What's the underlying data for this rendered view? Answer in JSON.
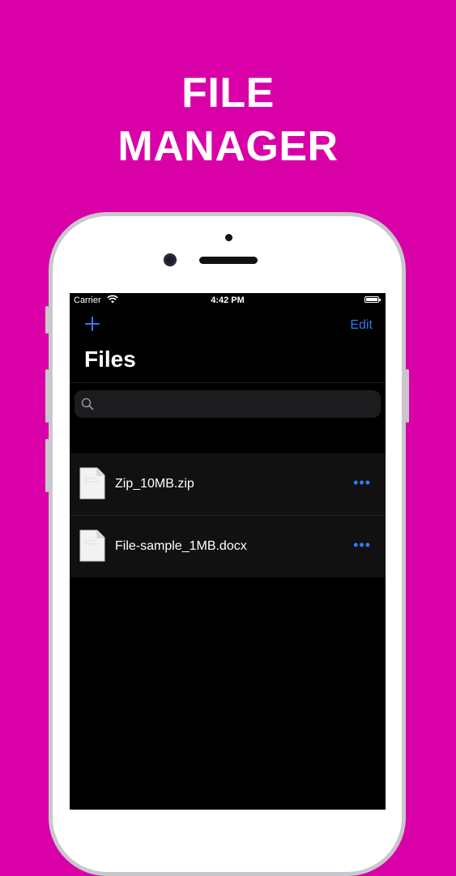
{
  "banner": {
    "line1": "FILE",
    "line2": "MANAGER"
  },
  "status_bar": {
    "carrier": "Carrier",
    "time": "4:42 PM"
  },
  "nav": {
    "add_label": "+",
    "edit_label": "Edit",
    "title": "Files"
  },
  "search": {
    "placeholder": "",
    "value": ""
  },
  "files": [
    {
      "name": "Zip_10MB.zip",
      "more": "•••"
    },
    {
      "name": "File-sample_1MB.docx",
      "more": "•••"
    }
  ],
  "colors": {
    "background": "#d900a8",
    "accent": "#2f7cf6",
    "screen": "#000000"
  },
  "icons": {
    "add": "plus-icon",
    "search": "magnifier-icon",
    "file": "document-icon",
    "more": "ellipsis-icon",
    "wifi": "wifi-icon",
    "battery": "battery-icon"
  }
}
